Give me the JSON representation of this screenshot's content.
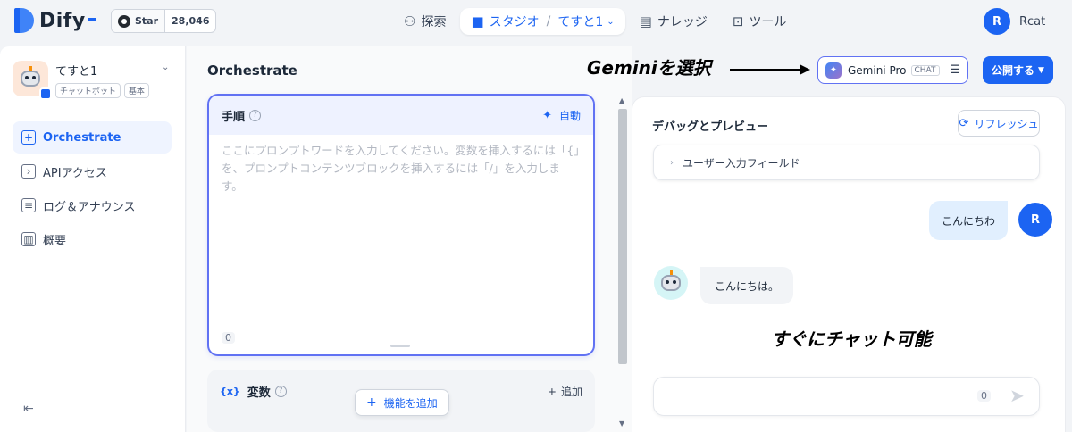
{
  "topbar": {
    "logo_text": "Dify",
    "github": {
      "star_label": "Star",
      "star_count": "28,046"
    },
    "nav": {
      "explore": "探索",
      "studio": "スタジオ",
      "app_name": "てすと1",
      "knowledge": "ナレッジ",
      "tools": "ツール"
    },
    "user": {
      "initial": "R",
      "name": "Rcat"
    }
  },
  "sidebar": {
    "app_name": "てすと1",
    "tags": [
      "チャットボット",
      "基本"
    ],
    "items": [
      {
        "label": "Orchestrate",
        "icon": "orchestrate-icon",
        "active": true
      },
      {
        "label": "APIアクセス",
        "icon": "terminal-icon",
        "active": false
      },
      {
        "label": "ログ＆アナウンス",
        "icon": "log-icon",
        "active": false
      },
      {
        "label": "概要",
        "icon": "chart-icon",
        "active": false
      }
    ]
  },
  "orchestrate": {
    "title": "Orchestrate",
    "prompt": {
      "label": "手順",
      "auto_label": "自動",
      "placeholder": "ここにプロンプトワードを入力してください。変数を挿入するには「{」を、プロンプトコンテンツブロックを挿入するには「/」を入力します。",
      "char_count": "0"
    },
    "variables": {
      "label": "変数",
      "add_label": "追加"
    },
    "feature_button": "機能を追加"
  },
  "header": {
    "model_name": "Gemini Pro",
    "model_mode": "CHAT",
    "publish_label": "公開する"
  },
  "debug": {
    "title": "デバッグとプレビュー",
    "refresh_label": "リフレッシュ",
    "input_fields_label": "ユーザー入力フィールド",
    "messages": {
      "user_text": "こんにちわ",
      "user_initial": "R",
      "bot_text": "こんにちは。"
    },
    "char_count": "0"
  },
  "annotations": {
    "select_gemini": "Geminiを選択",
    "chat_ready": "すぐにチャット可能"
  }
}
